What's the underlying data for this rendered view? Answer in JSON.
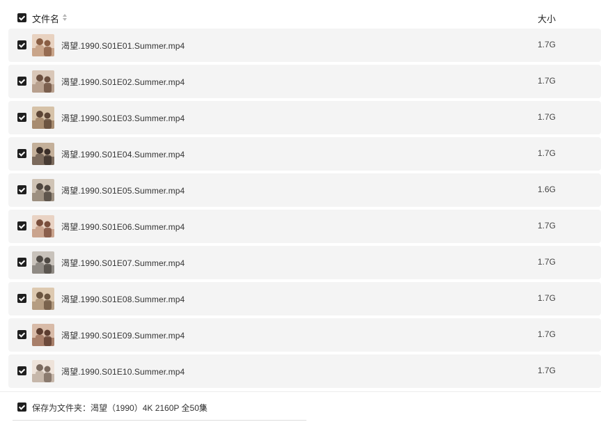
{
  "header": {
    "name_label": "文件名",
    "size_label": "大小"
  },
  "files": [
    {
      "name": "渴望.1990.S01E01.Summer.mp4",
      "size": "1.7G"
    },
    {
      "name": "渴望.1990.S01E02.Summer.mp4",
      "size": "1.7G"
    },
    {
      "name": "渴望.1990.S01E03.Summer.mp4",
      "size": "1.7G"
    },
    {
      "name": "渴望.1990.S01E04.Summer.mp4",
      "size": "1.7G"
    },
    {
      "name": "渴望.1990.S01E05.Summer.mp4",
      "size": "1.6G"
    },
    {
      "name": "渴望.1990.S01E06.Summer.mp4",
      "size": "1.7G"
    },
    {
      "name": "渴望.1990.S01E07.Summer.mp4",
      "size": "1.7G"
    },
    {
      "name": "渴望.1990.S01E08.Summer.mp4",
      "size": "1.7G"
    },
    {
      "name": "渴望.1990.S01E09.Summer.mp4",
      "size": "1.7G"
    },
    {
      "name": "渴望.1990.S01E10.Summer.mp4",
      "size": "1.7G"
    }
  ],
  "footer": {
    "save_label": "保存为文件夹：渴望（1990）4K 2160P 全50集",
    "chevron": "›"
  },
  "colors": {
    "checkbox": "#1f1f1f",
    "row_bg": "#f4f4f4"
  }
}
